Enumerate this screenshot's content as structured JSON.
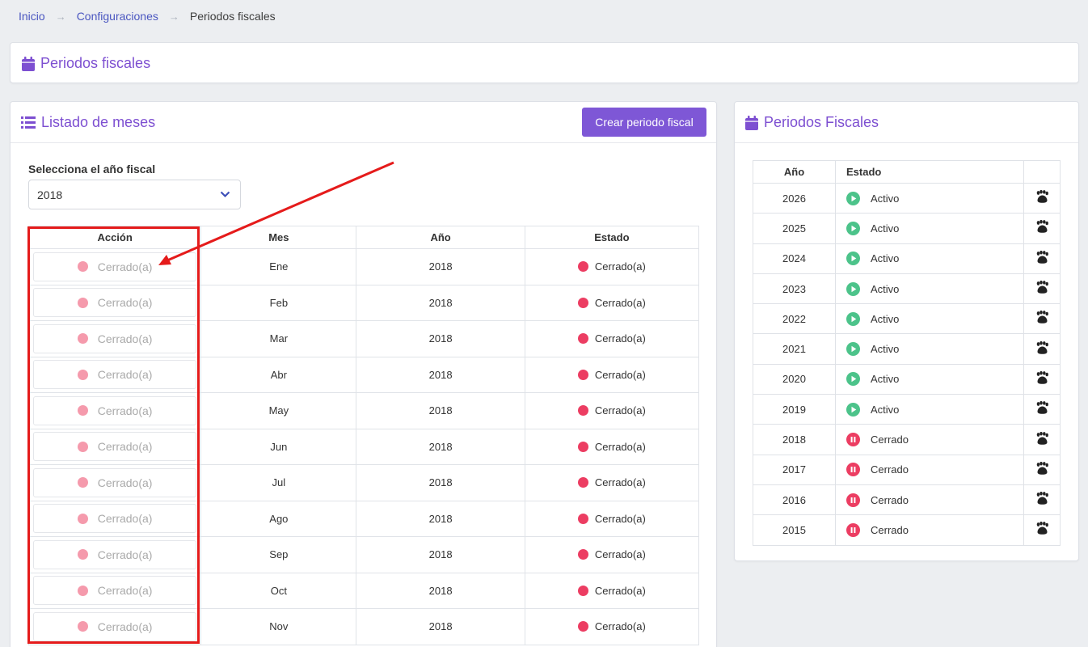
{
  "breadcrumb": {
    "home": "Inicio",
    "settings": "Configuraciones",
    "current": "Periodos fiscales"
  },
  "page_title": "Periodos fiscales",
  "months_panel": {
    "title": "Listado de meses",
    "create_button": "Crear periodo fiscal",
    "select_label": "Selecciona el año fiscal",
    "selected_year": "2018",
    "columns": [
      "Acción",
      "Mes",
      "Año",
      "Estado"
    ],
    "rows": [
      {
        "action": "Cerrado(a)",
        "month": "Ene",
        "year": "2018",
        "status": "Cerrado(a)"
      },
      {
        "action": "Cerrado(a)",
        "month": "Feb",
        "year": "2018",
        "status": "Cerrado(a)"
      },
      {
        "action": "Cerrado(a)",
        "month": "Mar",
        "year": "2018",
        "status": "Cerrado(a)"
      },
      {
        "action": "Cerrado(a)",
        "month": "Abr",
        "year": "2018",
        "status": "Cerrado(a)"
      },
      {
        "action": "Cerrado(a)",
        "month": "May",
        "year": "2018",
        "status": "Cerrado(a)"
      },
      {
        "action": "Cerrado(a)",
        "month": "Jun",
        "year": "2018",
        "status": "Cerrado(a)"
      },
      {
        "action": "Cerrado(a)",
        "month": "Jul",
        "year": "2018",
        "status": "Cerrado(a)"
      },
      {
        "action": "Cerrado(a)",
        "month": "Ago",
        "year": "2018",
        "status": "Cerrado(a)"
      },
      {
        "action": "Cerrado(a)",
        "month": "Sep",
        "year": "2018",
        "status": "Cerrado(a)"
      },
      {
        "action": "Cerrado(a)",
        "month": "Oct",
        "year": "2018",
        "status": "Cerrado(a)"
      },
      {
        "action": "Cerrado(a)",
        "month": "Nov",
        "year": "2018",
        "status": "Cerrado(a)"
      }
    ]
  },
  "fiscal_panel": {
    "title": "Periodos Fiscales",
    "columns": [
      "Año",
      "Estado",
      ""
    ],
    "rows": [
      {
        "year": "2026",
        "status": "Activo",
        "state": "active"
      },
      {
        "year": "2025",
        "status": "Activo",
        "state": "active"
      },
      {
        "year": "2024",
        "status": "Activo",
        "state": "active"
      },
      {
        "year": "2023",
        "status": "Activo",
        "state": "active"
      },
      {
        "year": "2022",
        "status": "Activo",
        "state": "active"
      },
      {
        "year": "2021",
        "status": "Activo",
        "state": "active"
      },
      {
        "year": "2020",
        "status": "Activo",
        "state": "active"
      },
      {
        "year": "2019",
        "status": "Activo",
        "state": "active"
      },
      {
        "year": "2018",
        "status": "Cerrado",
        "state": "closed"
      },
      {
        "year": "2017",
        "status": "Cerrado",
        "state": "closed"
      },
      {
        "year": "2016",
        "status": "Cerrado",
        "state": "closed"
      },
      {
        "year": "2015",
        "status": "Cerrado",
        "state": "closed"
      }
    ]
  },
  "colors": {
    "accent": "#7e57d6",
    "active_green": "#4cc38a",
    "closed_red": "#ec3d62",
    "annotation_red": "#e51b1b"
  },
  "icons": {
    "page_title": "calendar-icon",
    "months_title": "list-icon",
    "select": "chevron-down-icon",
    "active_status": "play-circle-icon",
    "closed_status": "pause-circle-icon",
    "row_action": "paw-icon"
  }
}
